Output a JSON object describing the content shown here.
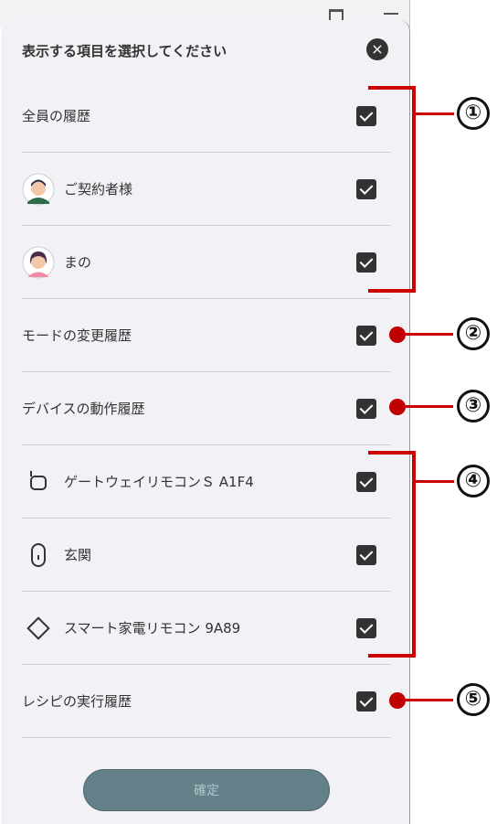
{
  "sheet": {
    "title": "表示する項目を選択してください",
    "close_icon": "×",
    "confirm_label": "確定"
  },
  "items": [
    {
      "label": "全員の履歴",
      "checked": true
    },
    {
      "label": "ご契約者様",
      "checked": true,
      "icon": "avatar-male-icon"
    },
    {
      "label": "まの",
      "checked": true,
      "icon": "avatar-female-icon"
    },
    {
      "label": "モードの変更履歴",
      "checked": true
    },
    {
      "label": "デバイスの動作履歴",
      "checked": true
    },
    {
      "label": "ゲートウェイリモコンＳ A1F4",
      "checked": true,
      "icon": "gateway-remote-icon"
    },
    {
      "label": "玄関",
      "checked": true,
      "icon": "door-sensor-icon"
    },
    {
      "label": "スマート家電リモコン 9A89",
      "checked": true,
      "icon": "smart-remote-icon"
    },
    {
      "label": "レシピの実行履歴",
      "checked": true
    }
  ],
  "annotations": [
    "①",
    "②",
    "③",
    "④",
    "⑤"
  ],
  "colors": {
    "accent": "#cc0000",
    "sheet_bg": "#f2f2f6",
    "confirm_bg": "#648089"
  }
}
